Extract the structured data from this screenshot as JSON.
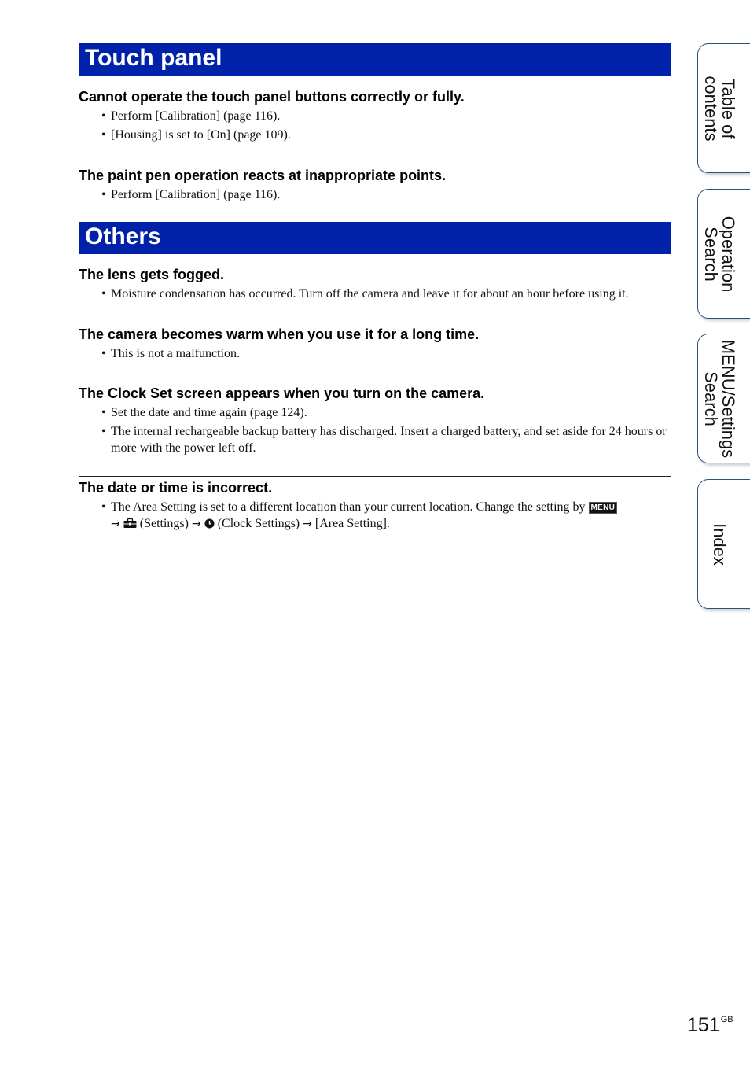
{
  "sections": [
    {
      "title": "Touch panel",
      "topics": [
        {
          "title": "Cannot operate the touch panel buttons correctly or fully.",
          "bullets": [
            "Perform [Calibration] (page 116).",
            "[Housing] is set to [On] (page 109)."
          ]
        },
        {
          "title": "The paint pen operation reacts at inappropriate points.",
          "bullets": [
            "Perform [Calibration] (page 116)."
          ]
        }
      ]
    },
    {
      "title": "Others",
      "topics": [
        {
          "title": "The lens gets fogged.",
          "bullets": [
            "Moisture condensation has occurred. Turn off the camera and leave it for about an hour before using it."
          ]
        },
        {
          "title": "The camera becomes warm when you use it for a long time.",
          "bullets": [
            "This is not a malfunction."
          ]
        },
        {
          "title": "The Clock Set screen appears when you turn on the camera.",
          "bullets": [
            "Set the date and time again (page 124).",
            "The internal rechargeable backup battery has discharged. Insert a charged battery, and set aside for 24 hours or more with the power left off."
          ]
        },
        {
          "title": "The date or time is incorrect.",
          "bullet_rich": {
            "prefix": "The Area Setting is set to a different location than your current location. Change the setting by ",
            "menu_badge": "MENU",
            "arrow": "→",
            "settings_label": " (Settings) ",
            "clock_label": " (Clock Settings) ",
            "suffix": " [Area Setting]."
          }
        }
      ]
    }
  ],
  "side_tabs": [
    {
      "label": "Table of\ncontents",
      "icon": ""
    },
    {
      "label": "Operation\nSearch"
    },
    {
      "label": "MENU/Settings\nSearch"
    },
    {
      "label": "Index"
    }
  ],
  "page": {
    "number": "151",
    "suffix": "GB"
  },
  "colors": {
    "header_bg": "#0022aa",
    "tab_border": "#2b4f7e"
  }
}
